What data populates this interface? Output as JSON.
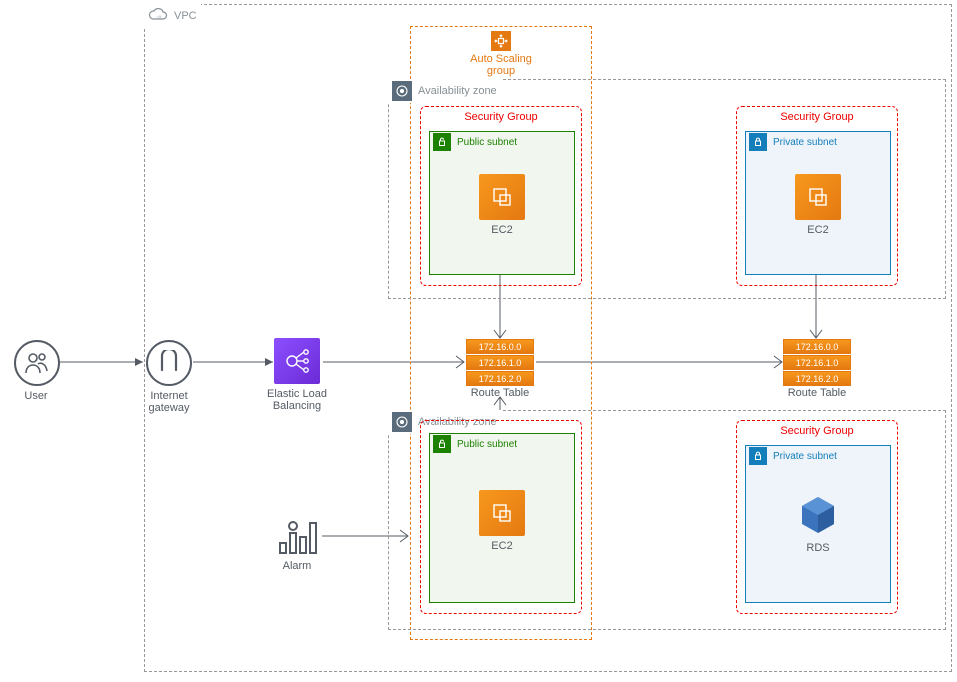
{
  "diagram": {
    "user_label": "User",
    "igw_label": "Internet gateway",
    "elb_label": "Elastic Load Balancing",
    "alarm_label": "Alarm",
    "vpc_label": "VPC",
    "asg_label": "Auto Scaling group",
    "az_label": "Availability zone",
    "sg_label": "Security Group",
    "public_subnet_label": "Public subnet",
    "private_subnet_label": "Private subnet",
    "ec2_label": "EC2",
    "rds_label": "RDS",
    "route_table_label": "Route Table",
    "routes": [
      "172.16.0.0",
      "172.16.1.0",
      "172.16.2.0"
    ]
  },
  "icons": {
    "users": "users-icon",
    "igw": "internet-gateway-icon",
    "elb": "elastic-load-balancing-icon",
    "ec2": "ec2-icon",
    "rds": "rds-icon",
    "alarm": "alarm-icon",
    "vpc": "vpc-icon",
    "asg": "auto-scaling-group-icon",
    "az": "availability-zone-icon",
    "lock": "lock-icon"
  }
}
